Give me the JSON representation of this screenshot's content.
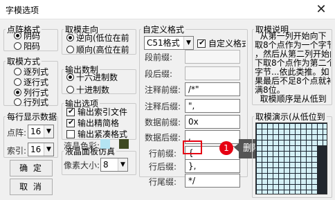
{
  "window": {
    "title": "字模选项",
    "close_glyph": "✕"
  },
  "dot_format": {
    "legend": "点阵格式",
    "options": [
      {
        "label": "阴码",
        "selected": true
      },
      {
        "label": "阳码",
        "selected": false
      }
    ]
  },
  "sampling": {
    "legend": "取模方式",
    "options": [
      {
        "label": "逐列式",
        "selected": false
      },
      {
        "label": "逐行式",
        "selected": false
      },
      {
        "label": "列行式",
        "selected": true
      },
      {
        "label": "行列式",
        "selected": false
      }
    ]
  },
  "per_line": {
    "legend": "每行显示数据",
    "dots_label": "点阵:",
    "dots_value": "16",
    "index_label": "索引:",
    "index_value": "16"
  },
  "buttons": {
    "ok": "确 定",
    "cancel": "取 消"
  },
  "direction": {
    "legend": "取模走向",
    "options": [
      {
        "label": "逆向(低位在前",
        "selected": true
      },
      {
        "label": "顺向(高位在前",
        "selected": false
      }
    ]
  },
  "output_base": {
    "legend": "输出数制",
    "options": [
      {
        "label": "十六进制数",
        "selected": true
      },
      {
        "label": "十进制数",
        "selected": false
      }
    ]
  },
  "output_options": {
    "legend": "输出选项",
    "items": [
      {
        "label": "输出索引文件",
        "checked": true
      },
      {
        "label": "输出精简格",
        "checked": true
      },
      {
        "label": "输出紧凑格式",
        "checked": false
      }
    ]
  },
  "lcd_panel": {
    "legend": "液晶面板仿真",
    "color_label": "液晶色彩:",
    "color_light": "#b4e4f2",
    "color_dark": "#3f4a22",
    "pixel_size_label": "像素大小:",
    "pixel_size_value": "8"
  },
  "custom_format": {
    "legend": "自定义格式",
    "format_select": "C51格式",
    "custom_checkbox_label": "自定义格式",
    "custom_checked": true,
    "fields": [
      {
        "label": "段前缀:",
        "value": "",
        "disabled": true
      },
      {
        "label": "段后缀:",
        "value": "",
        "disabled": true
      },
      {
        "label": "注释前缀:",
        "value": "/*\"",
        "disabled": false
      },
      {
        "label": "注释后缀:",
        "value": "\",",
        "disabled": false
      },
      {
        "label": "数据前缀:",
        "value": "0x",
        "disabled": false
      },
      {
        "label": "数据后缀:",
        "value": ",",
        "disabled": false
      },
      {
        "label": "行前缀:",
        "value": "{",
        "disabled": false
      },
      {
        "label": "行后缀:",
        "value": "},",
        "disabled": false
      },
      {
        "label": "行尾缀:",
        "value": "*/",
        "disabled": false
      }
    ]
  },
  "annotation": {
    "number": "1",
    "text": "删除这个括号",
    "accent": "#e60012"
  },
  "description": {
    "legend": "取模说明",
    "text": "  从第一列开始向下\n取8个点作为一个字节\n，然后从第二列开始向\n下取8个点作为第二个\n字节...依此类推。如\n果最后不足8个点就补\n满8位。\n  取模顺序是从低到"
  },
  "demo": {
    "legend": "取模演示(从低位到"
  }
}
